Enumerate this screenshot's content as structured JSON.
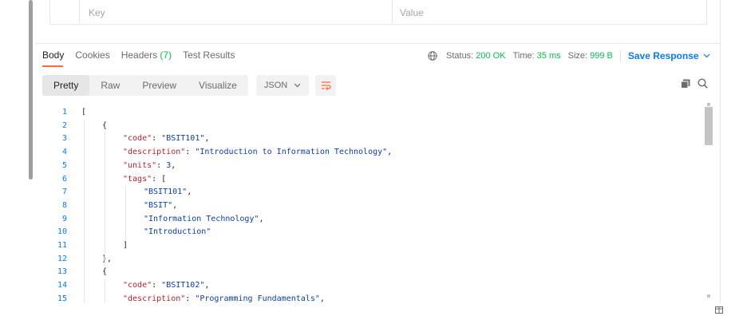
{
  "params": {
    "key_placeholder": "Key",
    "value_placeholder": "Value"
  },
  "response_tabs": [
    {
      "label": "Body"
    },
    {
      "label": "Cookies"
    },
    {
      "label": "Headers",
      "count": "(7)"
    },
    {
      "label": "Test Results"
    }
  ],
  "status": {
    "status_label": "Status:",
    "status_value": "200 OK",
    "time_label": "Time:",
    "time_value": "35 ms",
    "size_label": "Size:",
    "size_value": "999 B",
    "save_label": "Save Response"
  },
  "view_modes": [
    "Pretty",
    "Raw",
    "Preview",
    "Visualize"
  ],
  "format_select": "JSON",
  "colors": {
    "accent": "#ff6c37",
    "success": "#0cbb52",
    "link": "#097bed",
    "key": "#b4232f",
    "string": "#0b3ea3"
  },
  "icons": [
    "globe-icon",
    "chevron-down-icon",
    "wrap-lines-icon",
    "copy-icon",
    "search-icon",
    "layout-icon"
  ],
  "code_lines": [
    {
      "n": "1",
      "ind": 0,
      "parts": [
        [
          "p",
          "["
        ]
      ]
    },
    {
      "n": "2",
      "ind": 1,
      "parts": [
        [
          "p",
          "{"
        ]
      ]
    },
    {
      "n": "3",
      "ind": 2,
      "parts": [
        [
          "k",
          "\"code\""
        ],
        [
          "p",
          ": "
        ],
        [
          "s",
          "\"BSIT101\""
        ],
        [
          "p",
          ","
        ]
      ]
    },
    {
      "n": "4",
      "ind": 2,
      "parts": [
        [
          "k",
          "\"description\""
        ],
        [
          "p",
          ": "
        ],
        [
          "s",
          "\"Introduction to Information Technology\""
        ],
        [
          "p",
          ","
        ]
      ]
    },
    {
      "n": "5",
      "ind": 2,
      "parts": [
        [
          "k",
          "\"units\""
        ],
        [
          "p",
          ": "
        ],
        [
          "n",
          "3"
        ],
        [
          "p",
          ","
        ]
      ]
    },
    {
      "n": "6",
      "ind": 2,
      "parts": [
        [
          "k",
          "\"tags\""
        ],
        [
          "p",
          ": ["
        ]
      ]
    },
    {
      "n": "7",
      "ind": 3,
      "parts": [
        [
          "s",
          "\"BSIT101\""
        ],
        [
          "p",
          ","
        ]
      ]
    },
    {
      "n": "8",
      "ind": 3,
      "parts": [
        [
          "s",
          "\"BSIT\""
        ],
        [
          "p",
          ","
        ]
      ]
    },
    {
      "n": "9",
      "ind": 3,
      "parts": [
        [
          "s",
          "\"Information Technology\""
        ],
        [
          "p",
          ","
        ]
      ]
    },
    {
      "n": "10",
      "ind": 3,
      "parts": [
        [
          "s",
          "\"Introduction\""
        ]
      ]
    },
    {
      "n": "11",
      "ind": 2,
      "parts": [
        [
          "p",
          "]"
        ]
      ]
    },
    {
      "n": "12",
      "ind": 1,
      "parts": [
        [
          "p",
          "},"
        ]
      ]
    },
    {
      "n": "13",
      "ind": 1,
      "parts": [
        [
          "p",
          "{"
        ]
      ]
    },
    {
      "n": "14",
      "ind": 2,
      "parts": [
        [
          "k",
          "\"code\""
        ],
        [
          "p",
          ": "
        ],
        [
          "s",
          "\"BSIT102\""
        ],
        [
          "p",
          ","
        ]
      ]
    },
    {
      "n": "15",
      "ind": 2,
      "parts": [
        [
          "k",
          "\"description\""
        ],
        [
          "p",
          ": "
        ],
        [
          "s",
          "\"Programming Fundamentals\""
        ],
        [
          "p",
          ","
        ]
      ]
    }
  ]
}
